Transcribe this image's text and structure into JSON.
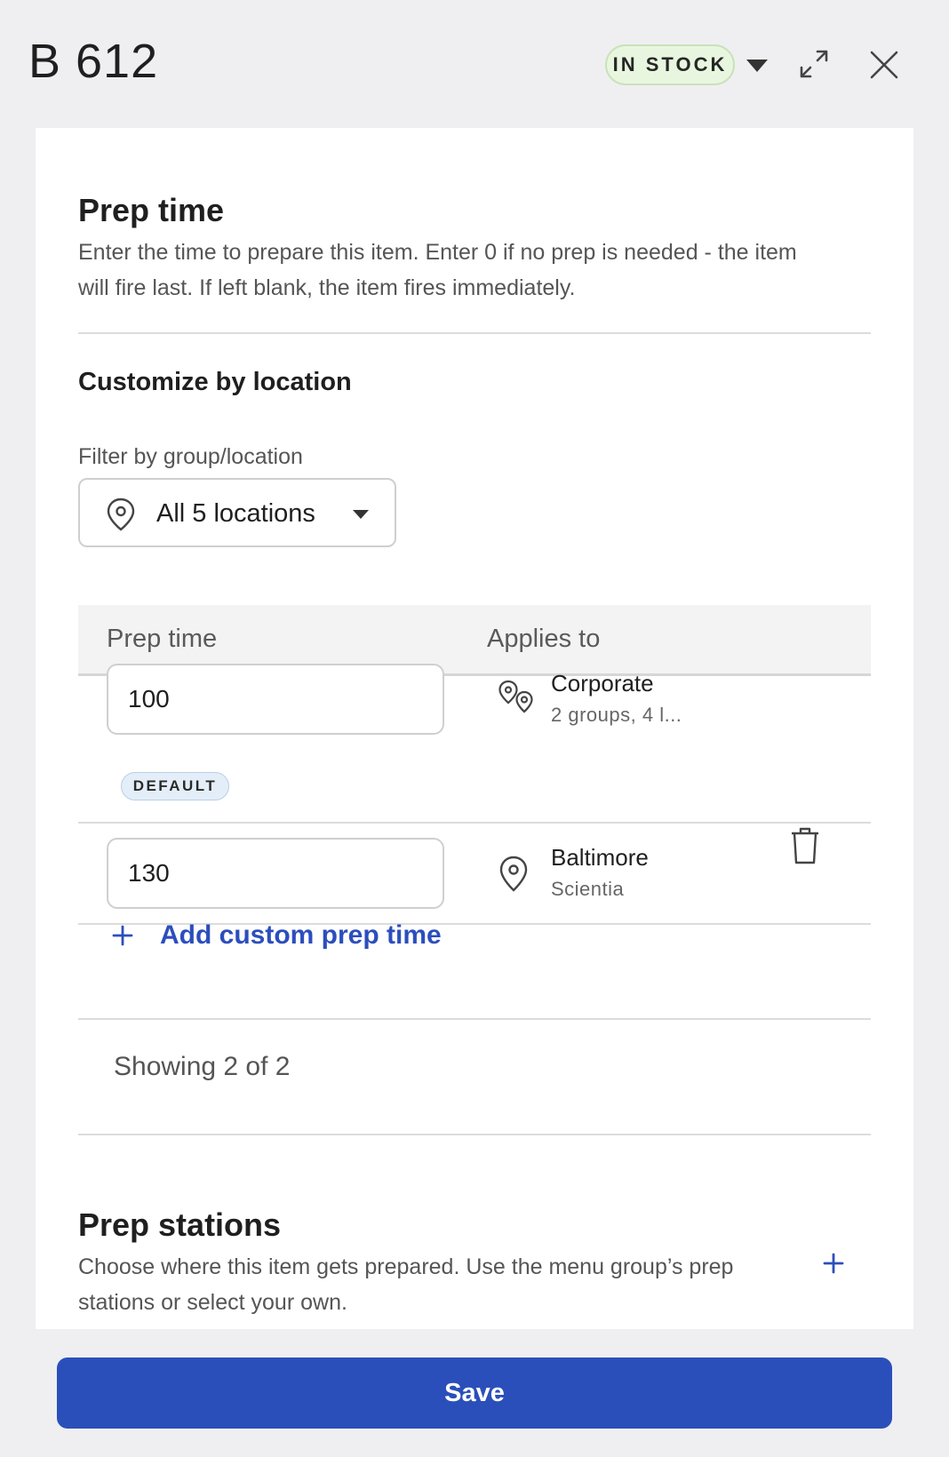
{
  "header": {
    "title": "B 612",
    "status_badge": "IN STOCK"
  },
  "prep_time": {
    "title": "Prep time",
    "description": "Enter the time to prepare this item. Enter 0 if no prep is needed - the item will fire last. If left blank, the item fires immediately."
  },
  "customize": {
    "title": "Customize by location",
    "filter_label": "Filter by group/location",
    "filter_value": "All 5 locations"
  },
  "table": {
    "headers": [
      "Prep time",
      "Applies to"
    ],
    "rows": [
      {
        "value": "100",
        "tag": "DEFAULT",
        "location": "Corporate",
        "detail": "2 groups, 4 l..."
      },
      {
        "value": "130",
        "location": "Baltimore",
        "detail": "Scientia"
      }
    ],
    "add_label": "Add custom prep time",
    "showing": "Showing 2 of 2"
  },
  "prep_stations": {
    "title": "Prep stations",
    "description": "Choose where this item gets prepared. Use the menu group’s prep stations or select your own."
  },
  "footer": {
    "save_label": "Save"
  },
  "colors": {
    "accent": "#2b4fba",
    "link": "#2c4ebd",
    "badge_green": "#e9f6df",
    "badge_blue": "#e4eef8",
    "page_bg": "#efeff2"
  }
}
